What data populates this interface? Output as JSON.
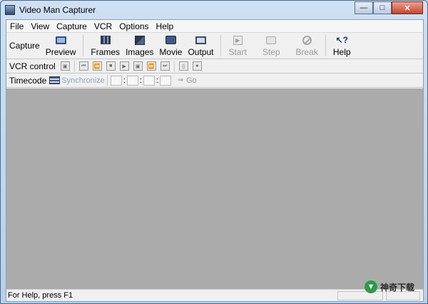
{
  "window": {
    "title": "Video Man Capturer",
    "controls": {
      "minimize": "—",
      "maximize": "□",
      "close": "✕"
    }
  },
  "menu": [
    "File",
    "View",
    "Capture",
    "VCR",
    "Options",
    "Help"
  ],
  "capture_toolbar": {
    "label": "Capture",
    "buttons": [
      {
        "label": "Preview",
        "icon": "monitor-icon",
        "enabled": true
      },
      {
        "label": "Frames",
        "icon": "frames-icon",
        "enabled": true
      },
      {
        "label": "Images",
        "icon": "images-icon",
        "enabled": true
      },
      {
        "label": "Movie",
        "icon": "movie-icon",
        "enabled": true
      },
      {
        "label": "Output",
        "icon": "output-icon",
        "enabled": true
      },
      {
        "label": "Start",
        "icon": "play-icon",
        "enabled": false
      },
      {
        "label": "Step",
        "icon": "camera-icon",
        "enabled": false
      },
      {
        "label": "Break",
        "icon": "break-icon",
        "enabled": false
      },
      {
        "label": "Help",
        "icon": "help-icon",
        "enabled": true
      }
    ]
  },
  "vcr_toolbar": {
    "label": "VCR control",
    "buttons": [
      "eject-icon",
      "rewind-start-icon",
      "rewind-icon",
      "stop-icon",
      "play-icon",
      "pause-icon",
      "fast-forward-icon",
      "forward-end-icon",
      "frame-icon",
      "record-icon"
    ]
  },
  "timecode_toolbar": {
    "label": "Timecode",
    "sync_label": "Synchronize",
    "separator": ":",
    "go_label": "Go"
  },
  "status": {
    "help_text": "For Help, press F1"
  },
  "watermark": {
    "text": "神奇下载"
  },
  "colors": {
    "work_area": "#ababab",
    "disabled_text": "#9a9a9a"
  }
}
